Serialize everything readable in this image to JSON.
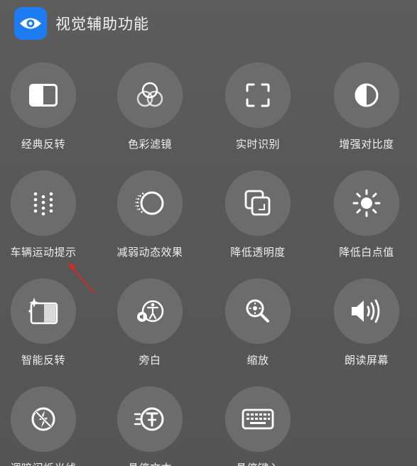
{
  "header": {
    "title": "视觉辅助功能",
    "icon": "eye-icon"
  },
  "colors": {
    "accent": "#1e7cf2",
    "annotation": "#d42a2a"
  },
  "tiles": [
    {
      "label": "经典反转",
      "icon": "classic-invert-icon"
    },
    {
      "label": "色彩滤镜",
      "icon": "color-filter-icon"
    },
    {
      "label": "实时识别",
      "icon": "live-recognition-icon"
    },
    {
      "label": "增强对比度",
      "icon": "contrast-icon"
    },
    {
      "label": "车辆运动提示",
      "icon": "vehicle-motion-dots-icon"
    },
    {
      "label": "减弱动态效果",
      "icon": "reduce-motion-icon"
    },
    {
      "label": "降低透明度",
      "icon": "reduce-transparency-icon"
    },
    {
      "label": "降低白点值",
      "icon": "brightness-icon"
    },
    {
      "label": "智能反转",
      "icon": "smart-invert-icon"
    },
    {
      "label": "旁白",
      "icon": "voiceover-icon"
    },
    {
      "label": "缩放",
      "icon": "zoom-icon"
    },
    {
      "label": "朗读屏幕",
      "icon": "speaker-icon"
    },
    {
      "label": "调暗闪烁光线",
      "icon": "dim-flashing-icon"
    },
    {
      "label": "悬停文本",
      "icon": "hover-text-icon"
    },
    {
      "label": "悬停键入",
      "icon": "keyboard-icon"
    }
  ]
}
